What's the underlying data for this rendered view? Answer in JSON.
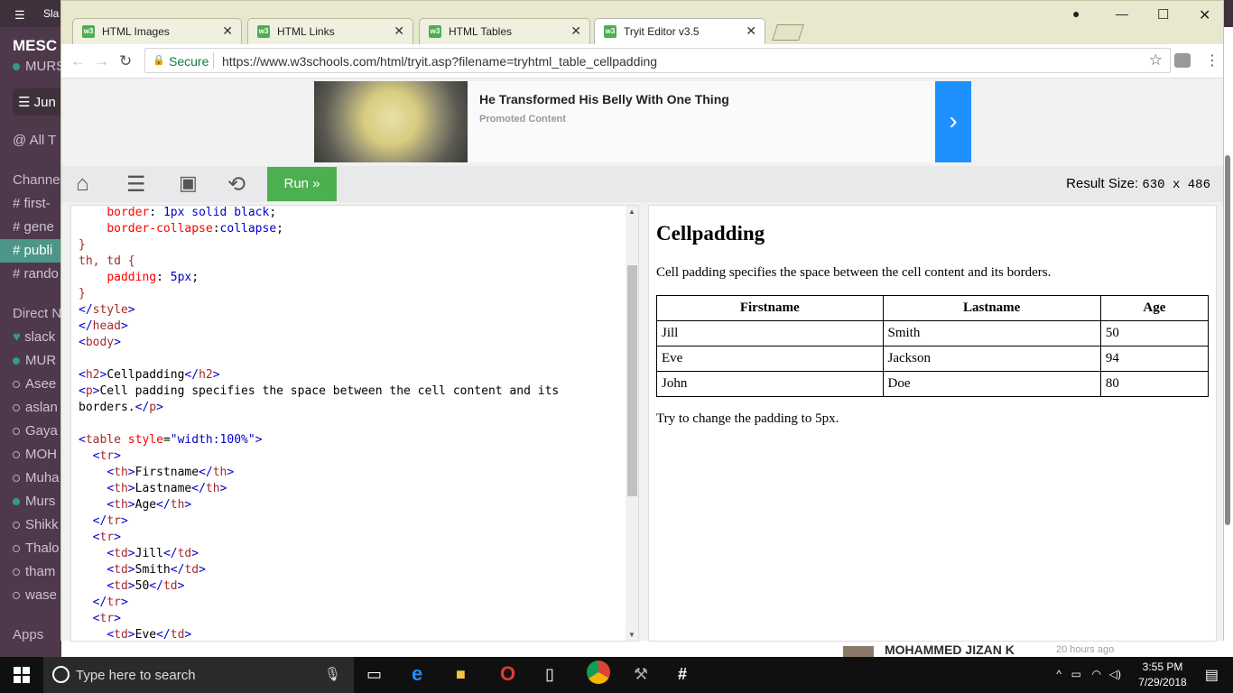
{
  "slack": {
    "title_text": "Sla",
    "workspace": "MESC",
    "user": "MURS",
    "jump": "Jun",
    "all_threads": "All T",
    "channels_header": "Channe",
    "channels": [
      "first-",
      "gene",
      "publi",
      "rando"
    ],
    "dm_header": "Direct N",
    "dms": [
      "slack",
      "MUR",
      "Asee",
      "aslan",
      "Gaya",
      "MOH",
      "Muha",
      "Murs",
      "Shikk",
      "Thalo",
      "tham",
      "wase"
    ],
    "apps": "Apps",
    "footer_name": "MOHAMMED JIZAN K",
    "footer_time": "20 hours ago"
  },
  "browser": {
    "tabs": [
      {
        "label": "HTML Images",
        "close": "✕"
      },
      {
        "label": "HTML Links",
        "close": "✕"
      },
      {
        "label": "HTML Tables",
        "close": "✕"
      },
      {
        "label": "Tryit Editor v3.5",
        "close": "✕"
      }
    ],
    "favicon_text": "w3",
    "secure_label": "Secure",
    "url": "https://www.w3schools.com/html/tryit.asp?filename=tryhtml_table_cellpadding"
  },
  "ad": {
    "headline": "He Transformed His Belly With One Thing",
    "promoted": "Promoted Content"
  },
  "toolbar": {
    "run_label": "Run »",
    "result_size_label": "Result Size:",
    "result_size_value": "630 x 486"
  },
  "result": {
    "heading": "Cellpadding",
    "paragraph": "Cell padding specifies the space between the cell content and its borders.",
    "headers": [
      "Firstname",
      "Lastname",
      "Age"
    ],
    "rows": [
      [
        "Jill",
        "Smith",
        "50"
      ],
      [
        "Eve",
        "Jackson",
        "94"
      ],
      [
        "John",
        "Doe",
        "80"
      ]
    ],
    "note": "Try to change the padding to 5px."
  },
  "taskbar": {
    "search_placeholder": "Type here to search",
    "time": "3:55 PM",
    "date": "7/29/2018"
  }
}
